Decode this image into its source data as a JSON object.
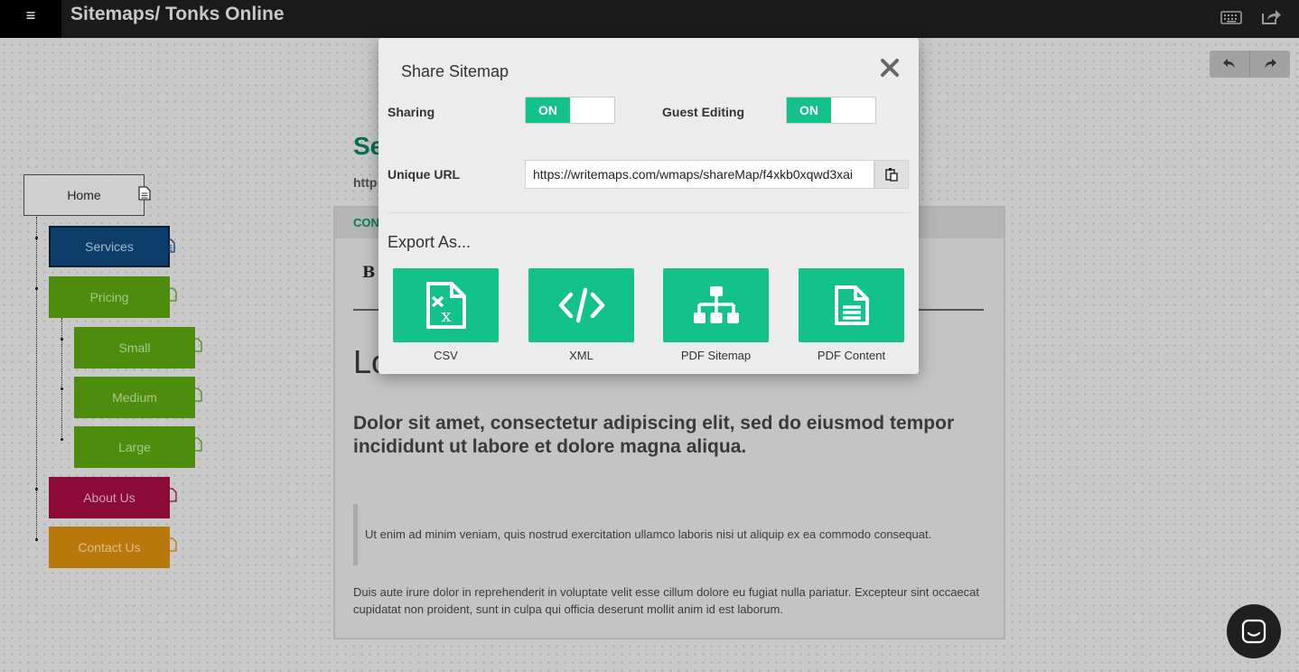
{
  "topbar": {
    "menu_glyph": "≡",
    "title": "Sitemaps/ Tonks Online",
    "icons": [
      "keyboard-icon",
      "share-icon"
    ]
  },
  "toolbar": {
    "icons": [
      "undo-icon",
      "redo-icon"
    ]
  },
  "sitemap": {
    "nodes": [
      {
        "label": "Home",
        "color": "#cfcfcf"
      },
      {
        "label": "Services",
        "color": "#0c3d6b"
      },
      {
        "label": "Pricing",
        "color": "#4e8c0e"
      },
      {
        "label": "Small",
        "color": "#4e8c0e"
      },
      {
        "label": "Medium",
        "color": "#4e8c0e"
      },
      {
        "label": "Large",
        "color": "#4e8c0e"
      },
      {
        "label": "About Us",
        "color": "#8c0a38"
      },
      {
        "label": "Contact Us",
        "color": "#b9780a"
      }
    ]
  },
  "background_page": {
    "title_fragment": "Se",
    "url_fragment": "http",
    "panel_tab_fragment": "CON",
    "bold_fragment": "B",
    "heading_fragment": "Lo",
    "subheading": "Dolor sit amet, consectetur adipiscing elit, sed do eiusmod tempor incididunt ut labore et dolore magna aliqua.",
    "quote": "Ut enim ad minim veniam, quis nostrud exercitation ullamco laboris nisi ut aliquip ex ea commodo consequat.",
    "paragraph": "Duis aute irure dolor in reprehenderit in voluptate velit esse cillum dolore eu fugiat nulla pariatur. Excepteur sint occaecat cupidatat non proident, sunt in culpa qui officia deserunt mollit anim id est laborum."
  },
  "modal": {
    "title": "Share Sitemap",
    "sharing_label": "Sharing",
    "sharing_state": "ON",
    "guest_editing_label": "Guest Editing",
    "guest_editing_state": "ON",
    "unique_url_label": "Unique URL",
    "unique_url_value": "https://writemaps.com/wmaps/shareMap/f4xkb0xqwd3xai",
    "export_title": "Export As...",
    "exports": [
      {
        "label": "CSV",
        "icon": "csv-file-icon"
      },
      {
        "label": "XML",
        "icon": "code-icon"
      },
      {
        "label": "PDF Sitemap",
        "icon": "sitemap-icon"
      },
      {
        "label": "PDF Content",
        "icon": "document-icon"
      }
    ],
    "accent_color": "#13c28b"
  },
  "chat": {
    "icon": "chat-icon"
  }
}
